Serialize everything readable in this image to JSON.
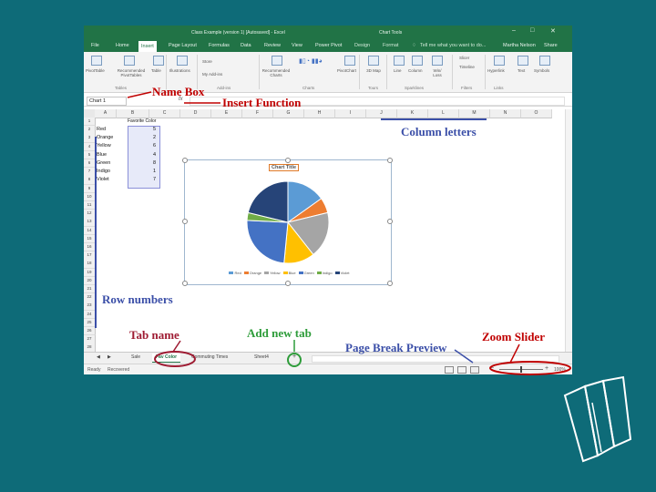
{
  "window": {
    "title": "Class Example (version 1) [Autosaved] - Excel",
    "context_label": "Chart Tools",
    "user": "Martha Nelson",
    "share_label": "Share"
  },
  "ribbon": {
    "tabs": [
      "File",
      "Home",
      "Insert",
      "Page Layout",
      "Formulas",
      "Data",
      "Review",
      "View",
      "Power Pivot",
      "Design",
      "Format"
    ],
    "active_tab": "Insert",
    "tell_me": "Tell me what you want to do...",
    "buttons": [
      {
        "label": "PivotTable"
      },
      {
        "label": "Recommended PivotTables"
      },
      {
        "label": "Table"
      },
      {
        "label": "Illustrations"
      },
      {
        "label": "Store"
      },
      {
        "label": "My Add-ins"
      },
      {
        "label": "Recommended Charts"
      },
      {
        "label": "PivotChart"
      },
      {
        "label": "3D Map"
      },
      {
        "label": "Line"
      },
      {
        "label": "Column"
      },
      {
        "label": "Win/ Loss"
      },
      {
        "label": "Slicer"
      },
      {
        "label": "Timeline"
      },
      {
        "label": "Hyperlink"
      },
      {
        "label": "Text"
      },
      {
        "label": "Symbols"
      }
    ],
    "groups": [
      "Tables",
      "Add-ins",
      "Charts",
      "Tours",
      "Sparklines",
      "Filters",
      "Links"
    ]
  },
  "formula_bar": {
    "name_box": "Chart 1",
    "fx": "fx"
  },
  "columns": [
    "A",
    "B",
    "C",
    "D",
    "E",
    "F",
    "G",
    "H",
    "I",
    "J",
    "K",
    "L",
    "M",
    "N",
    "O"
  ],
  "rows": [
    "1",
    "2",
    "3",
    "4",
    "5",
    "6",
    "7",
    "8",
    "9",
    "10",
    "11",
    "12",
    "13",
    "14",
    "15",
    "16",
    "17",
    "18",
    "19",
    "20",
    "21",
    "22",
    "23",
    "24",
    "25",
    "26",
    "27",
    "28"
  ],
  "table": {
    "header": "Favorite Color",
    "rows": [
      {
        "color": "Red",
        "count": "5"
      },
      {
        "color": "Orange",
        "count": "2"
      },
      {
        "color": "Yellow",
        "count": "6"
      },
      {
        "color": "Blue",
        "count": "4"
      },
      {
        "color": "Green",
        "count": "8"
      },
      {
        "color": "Indigo",
        "count": "1"
      },
      {
        "color": "Violet",
        "count": "7"
      }
    ]
  },
  "chart": {
    "title": "Chart Title",
    "legend": [
      "Red",
      "Orange",
      "Yellow",
      "Blue",
      "Green",
      "Indigo",
      "Violet"
    ],
    "slice_colors": [
      "#5b9bd5",
      "#ed7d31",
      "#a5a5a5",
      "#ffc000",
      "#4472c4",
      "#70ad47",
      "#264478"
    ]
  },
  "chart_data": {
    "type": "pie",
    "title": "Chart Title",
    "categories": [
      "Red",
      "Orange",
      "Yellow",
      "Blue",
      "Green",
      "Indigo",
      "Violet"
    ],
    "values": [
      5,
      2,
      6,
      4,
      8,
      1,
      7
    ]
  },
  "sheet_tabs": {
    "items": [
      "Sale",
      "Fav Color",
      "Commuting Times",
      "Sheet4"
    ],
    "active": "Fav Color",
    "add": "+"
  },
  "status_bar": {
    "ready": "Ready",
    "recovered": "Recovered",
    "zoom": "100%"
  },
  "annotations": {
    "name_box": "Name Box",
    "insert_function": "Insert Function",
    "column_letters": "Column letters",
    "row_numbers": "Row numbers",
    "tab_name": "Tab name",
    "add_new_tab": "Add new tab",
    "page_break_preview": "Page Break Preview",
    "zoom_slider": "Zoom Slider"
  },
  "colors": {
    "background": "#0e6b78",
    "excel_green": "#217346",
    "annotation_red": "#c00000",
    "annotation_blue": "#3b4fa8",
    "annotation_green": "#2e9c3a"
  }
}
